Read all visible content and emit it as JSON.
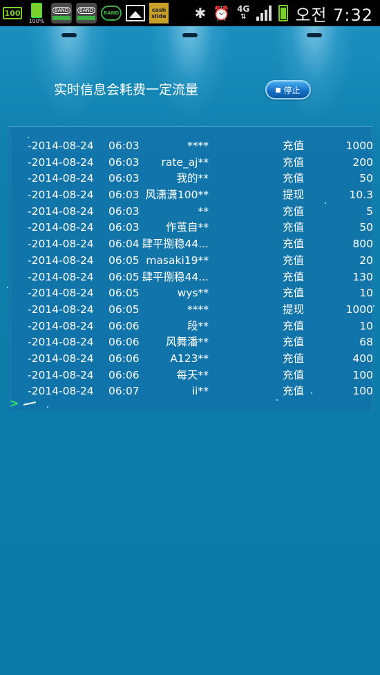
{
  "status_bar": {
    "battery_badge": "100",
    "battery_small_pct": "100%",
    "band1": "BAND",
    "band2": "BAND",
    "band3": "BAND",
    "cash_line1": "cash",
    "cash_line2": "slide",
    "network": "4G",
    "clock": "오전 7:32"
  },
  "header": {
    "notice": "实时信息会耗费一定流量",
    "stop_label": "停止"
  },
  "records": [
    {
      "date": "-2014-08-24",
      "time": "06:03",
      "user": "****",
      "type": "充值",
      "amount": "1000"
    },
    {
      "date": "-2014-08-24",
      "time": "06:03",
      "user": "rate_aj**",
      "type": "充值",
      "amount": "200"
    },
    {
      "date": "-2014-08-24",
      "time": "06:03",
      "user": "我的**",
      "type": "充值",
      "amount": "50"
    },
    {
      "date": "-2014-08-24",
      "time": "06:03",
      "user": "风潇潇100**",
      "type": "提现",
      "amount": "10.3"
    },
    {
      "date": "-2014-08-24",
      "time": "06:03",
      "user": "**",
      "type": "充值",
      "amount": "5"
    },
    {
      "date": "-2014-08-24",
      "time": "06:03",
      "user": "作茧自**",
      "type": "充值",
      "amount": "50"
    },
    {
      "date": "-2014-08-24",
      "time": "06:04",
      "user": "肆平捌稳44...",
      "type": "充值",
      "amount": "800"
    },
    {
      "date": "-2014-08-24",
      "time": "06:05",
      "user": "masaki19**",
      "type": "充值",
      "amount": "20"
    },
    {
      "date": "-2014-08-24",
      "time": "06:05",
      "user": "肆平捌稳44...",
      "type": "充值",
      "amount": "130"
    },
    {
      "date": "-2014-08-24",
      "time": "06:05",
      "user": "wys**",
      "type": "充值",
      "amount": "10"
    },
    {
      "date": "-2014-08-24",
      "time": "06:05",
      "user": "****",
      "type": "提现",
      "amount": "1000"
    },
    {
      "date": "-2014-08-24",
      "time": "06:06",
      "user": "段**",
      "type": "充值",
      "amount": "10"
    },
    {
      "date": "-2014-08-24",
      "time": "06:06",
      "user": "风舞潘**",
      "type": "充值",
      "amount": "68"
    },
    {
      "date": "-2014-08-24",
      "time": "06:06",
      "user": "A123**",
      "type": "充值",
      "amount": "400"
    },
    {
      "date": "-2014-08-24",
      "time": "06:06",
      "user": "每天**",
      "type": "充值",
      "amount": "100"
    },
    {
      "date": "-2014-08-24",
      "time": "06:07",
      "user": "ii**",
      "type": "充值",
      "amount": "100"
    }
  ],
  "console": {
    "prompt": ">"
  }
}
